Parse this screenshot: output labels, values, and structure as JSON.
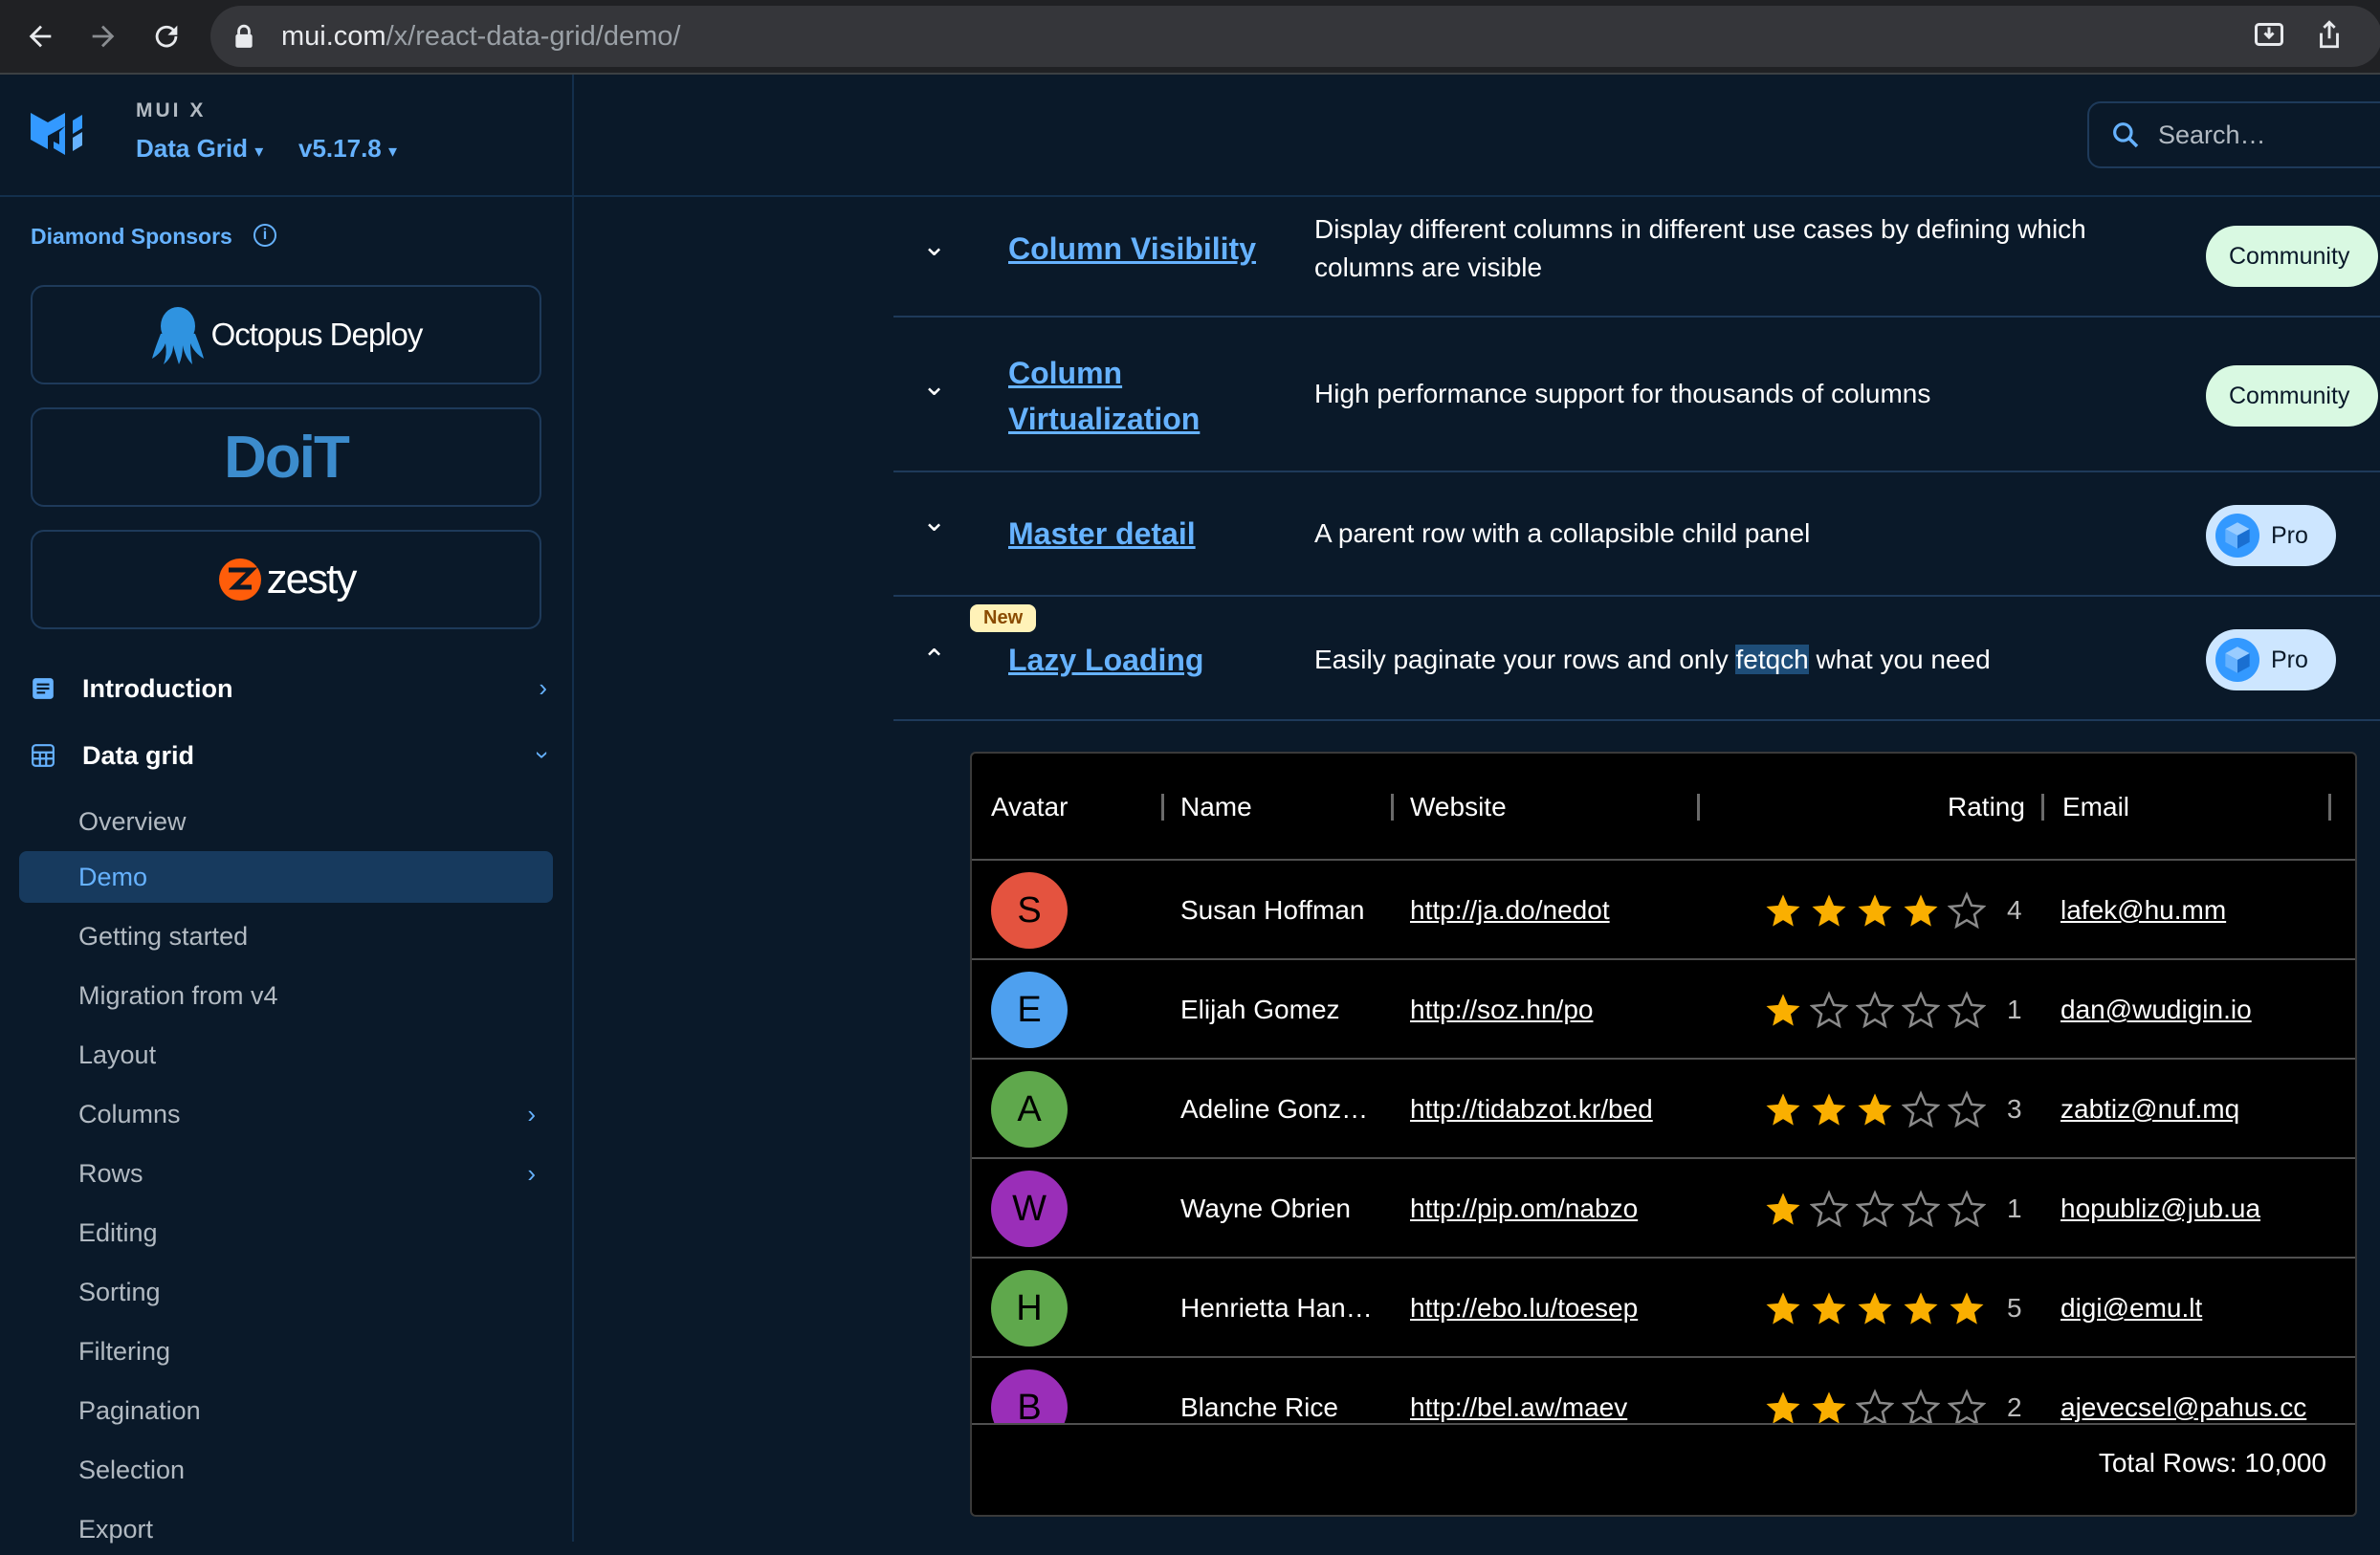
{
  "browser": {
    "url_domain": "mui.com",
    "url_path": "/x/react-data-grid/demo/"
  },
  "sidebar": {
    "kicker": "MUI X",
    "product": "Data Grid",
    "version": "v5.17.8",
    "sponsors_label": "Diamond Sponsors",
    "sponsors": [
      "Octopus Deploy",
      "DoiT",
      "zesty"
    ],
    "groups": [
      {
        "label": "Introduction",
        "icon": "article-icon"
      },
      {
        "label": "Data grid",
        "icon": "grid-table-icon"
      }
    ],
    "items": [
      {
        "label": "Overview"
      },
      {
        "label": "Demo",
        "active": true
      },
      {
        "label": "Getting started"
      },
      {
        "label": "Migration from v4"
      },
      {
        "label": "Layout"
      },
      {
        "label": "Columns",
        "expandable": true
      },
      {
        "label": "Rows",
        "expandable": true
      },
      {
        "label": "Editing"
      },
      {
        "label": "Sorting"
      },
      {
        "label": "Filtering"
      },
      {
        "label": "Pagination"
      },
      {
        "label": "Selection"
      },
      {
        "label": "Export"
      }
    ]
  },
  "search": {
    "placeholder": "Search…"
  },
  "features": [
    {
      "name": "Column Visibility",
      "desc": "Display different columns in different use cases by defining which columns are visible",
      "plan": "Community"
    },
    {
      "name": "Column Virtualization",
      "name_line1": "Column",
      "name_line2": "Virtualization",
      "desc": "High performance support for thousands of columns",
      "plan": "Community"
    },
    {
      "name": "Master detail",
      "desc": "A parent row with a collapsible child panel",
      "plan": "Pro"
    },
    {
      "name": "Lazy Loading",
      "new_label": "New",
      "desc_before": "Easily paginate your rows and only ",
      "desc_highlight": "fetqch",
      "desc_after": " what you need",
      "plan": "Pro"
    }
  ],
  "grid": {
    "columns": [
      "Avatar",
      "Name",
      "Website",
      "Rating",
      "Email"
    ],
    "rows": [
      {
        "initial": "S",
        "color": "#e4533f",
        "name": "Susan Hoffman",
        "website": "http://ja.do/nedot",
        "rating": 4,
        "email": "lafek@hu.mm"
      },
      {
        "initial": "E",
        "color": "#4ea0ef",
        "name": "Elijah Gomez",
        "website": "http://soz.hn/po",
        "rating": 1,
        "email": "dan@wudigin.io"
      },
      {
        "initial": "A",
        "color": "#5fa84c",
        "name": "Adeline Gonz…",
        "website": "http://tidabzot.kr/bed",
        "rating": 3,
        "email": "zabtiz@nuf.mq"
      },
      {
        "initial": "W",
        "color": "#9a2eb8",
        "name": "Wayne Obrien",
        "website": "http://pip.om/nabzo",
        "rating": 1,
        "email": "hopubliz@jub.ua"
      },
      {
        "initial": "H",
        "color": "#5fa84c",
        "name": "Henrietta Han…",
        "website": "http://ebo.lu/toesep",
        "rating": 5,
        "email": "digi@emu.lt"
      },
      {
        "initial": "B",
        "color": "#9a2eb8",
        "name": "Blanche Rice",
        "website": "http://bel.aw/maev",
        "rating": 2,
        "email": "ajevecsel@pahus.cc"
      }
    ],
    "footer": "Total Rows: 10,000"
  },
  "colors": {
    "background": "#0a1929",
    "accent": "#66b2ff",
    "star_filled": "#faaf00"
  }
}
